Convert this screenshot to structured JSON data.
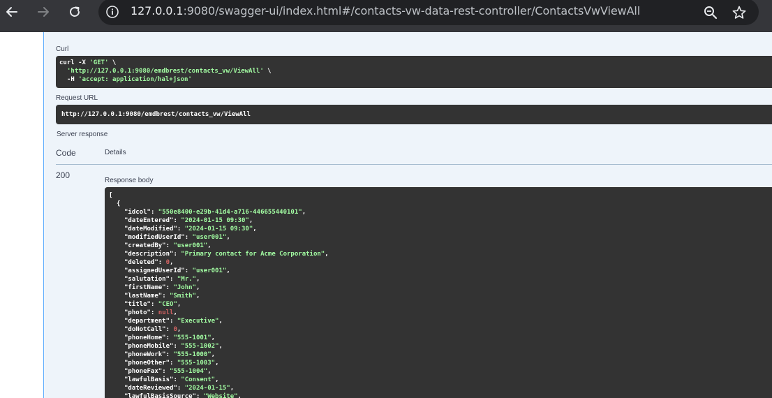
{
  "browser": {
    "url_host": "127.0.0.1",
    "url_path": ":9080/swagger-ui/index.html#/contacts-vw-data-rest-controller/ContactsVwViewAll"
  },
  "curl": {
    "label": "Curl",
    "line1_cmd": "curl -X ",
    "line1_str": "'GET'",
    "line1_tail": " \\",
    "line2_str": "'http://127.0.0.1:9080/emdbrest/contacts_vw/ViewAll'",
    "line2_tail": " \\",
    "line3_cmd": "-H ",
    "line3_str": "'accept: application/hal+json'"
  },
  "request_url": {
    "label": "Request URL",
    "value": "http://127.0.0.1:9080/emdbrest/contacts_vw/ViewAll"
  },
  "server_response": {
    "label": "Server response",
    "col_code": "Code",
    "col_details": "Details",
    "code": "200",
    "body_label": "Response body"
  },
  "response_body": {
    "open_bracket": "[",
    "open_brace": "{",
    "fields": [
      {
        "key": "\"idcol\"",
        "value": "\"550e8400-e29b-41d4-a716-446655440101\"",
        "type": "s"
      },
      {
        "key": "\"dateEntered\"",
        "value": "\"2024-01-15 09:30\"",
        "type": "s"
      },
      {
        "key": "\"dateModified\"",
        "value": "\"2024-01-15 09:30\"",
        "type": "s"
      },
      {
        "key": "\"modifiedUserId\"",
        "value": "\"user001\"",
        "type": "s"
      },
      {
        "key": "\"createdBy\"",
        "value": "\"user001\"",
        "type": "s"
      },
      {
        "key": "\"description\"",
        "value": "\"Primary contact for Acme Corporation\"",
        "type": "s"
      },
      {
        "key": "\"deleted\"",
        "value": "0",
        "type": "n"
      },
      {
        "key": "\"assignedUserId\"",
        "value": "\"user001\"",
        "type": "s"
      },
      {
        "key": "\"salutation\"",
        "value": "\"Mr.\"",
        "type": "s"
      },
      {
        "key": "\"firstName\"",
        "value": "\"John\"",
        "type": "s"
      },
      {
        "key": "\"lastName\"",
        "value": "\"Smith\"",
        "type": "s"
      },
      {
        "key": "\"title\"",
        "value": "\"CEO\"",
        "type": "s"
      },
      {
        "key": "\"photo\"",
        "value": "null",
        "type": "n"
      },
      {
        "key": "\"department\"",
        "value": "\"Executive\"",
        "type": "s"
      },
      {
        "key": "\"doNotCall\"",
        "value": "0",
        "type": "n"
      },
      {
        "key": "\"phoneHome\"",
        "value": "\"555-1001\"",
        "type": "s"
      },
      {
        "key": "\"phoneMobile\"",
        "value": "\"555-1002\"",
        "type": "s"
      },
      {
        "key": "\"phoneWork\"",
        "value": "\"555-1000\"",
        "type": "s"
      },
      {
        "key": "\"phoneOther\"",
        "value": "\"555-1003\"",
        "type": "s"
      },
      {
        "key": "\"phoneFax\"",
        "value": "\"555-1004\"",
        "type": "s"
      },
      {
        "key": "\"lawfulBasis\"",
        "value": "\"Consent\"",
        "type": "s"
      },
      {
        "key": "\"dateReviewed\"",
        "value": "\"2024-01-15\"",
        "type": "s"
      },
      {
        "key": "\"lawfulBasisSource\"",
        "value": "\"Website\"",
        "type": "s"
      }
    ]
  },
  "colors": {
    "toolbar_bg": "#35363a",
    "omnibox_bg": "#202124",
    "opblock_bg": "#eef4fa",
    "opblock_border": "#61affe",
    "code_bg": "#333333",
    "json_string": "#a2fca2",
    "json_number": "#d36363"
  },
  "icons": {
    "back": "back-arrow-icon",
    "forward": "forward-arrow-icon",
    "reload": "reload-icon",
    "info": "info-icon",
    "zoom": "zoom-icon",
    "bookmark": "bookmark-star-icon"
  }
}
